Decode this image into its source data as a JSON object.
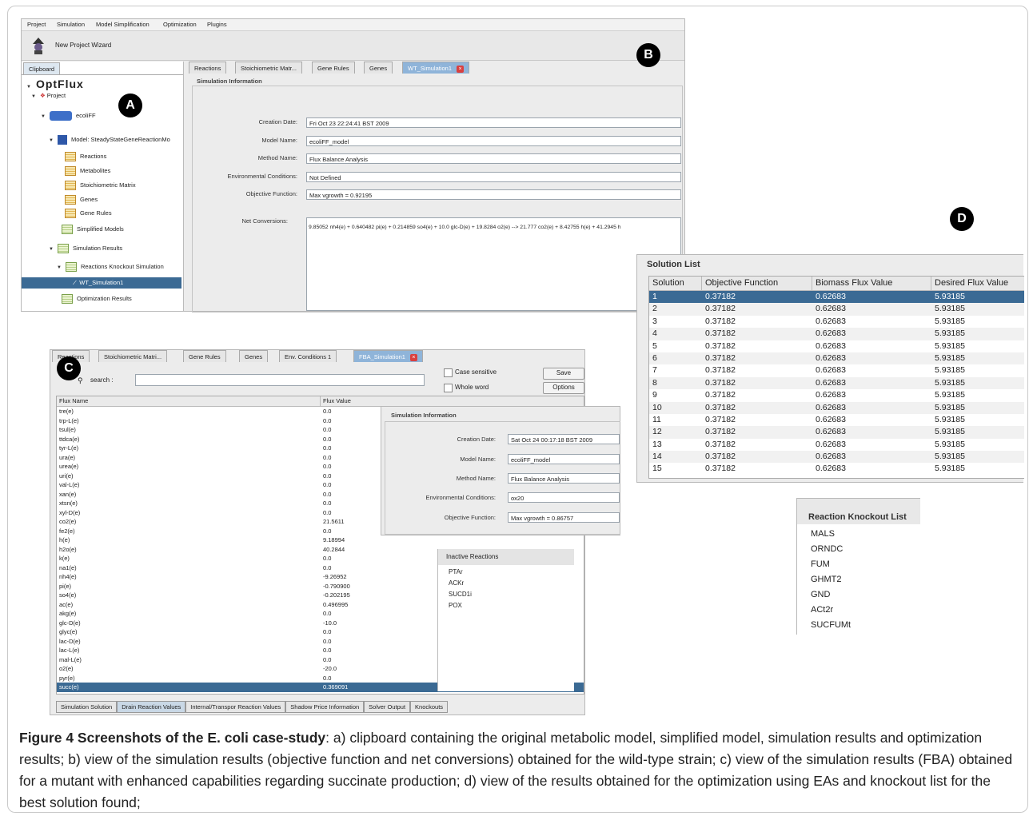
{
  "menu_items": [
    "Project",
    "Simulation",
    "Model Simplification",
    "Optimization",
    "Plugins"
  ],
  "toolbar": {
    "new_project": "New Project Wizard"
  },
  "badges": {
    "a": "A",
    "b": "B",
    "c": "C",
    "d": "D"
  },
  "panel_a": {
    "clipboard_tab": "Clipboard",
    "logo": "OptFlux",
    "tree": [
      {
        "label": "Project"
      },
      {
        "label": "ecoliFF"
      },
      {
        "label": "Model: SteadyStateGeneReactionMo"
      },
      {
        "label": "Reactions"
      },
      {
        "label": "Metabolites"
      },
      {
        "label": "Stoichiometric Matrix"
      },
      {
        "label": "Genes"
      },
      {
        "label": "Gene Rules"
      },
      {
        "label": "Simplified Models"
      },
      {
        "label": "Simulation Results"
      },
      {
        "label": "Reactions Knockout Simulation"
      },
      {
        "label": "WT_Simulation1"
      },
      {
        "label": "Optimization Results"
      }
    ]
  },
  "panel_b": {
    "tabs": [
      "Reactions",
      "Stoichiometric Matr...",
      "Gene Rules",
      "Genes",
      "WT_Simulation1"
    ],
    "section_title": "Simulation Information",
    "fields": [
      {
        "label": "Creation Date:",
        "value": "Fri Oct 23 22:24:41 BST 2009"
      },
      {
        "label": "Model Name:",
        "value": "ecoliFF_model"
      },
      {
        "label": "Method Name:",
        "value": "Flux Balance Analysis"
      },
      {
        "label": "Environmental Conditions:",
        "value": "Not Defined"
      },
      {
        "label": "Objective Function:",
        "value": "Max vgrowth  = 0.92195"
      }
    ],
    "net_label": "Net Conversions:",
    "net_value": "9.85052 nh4(e) + 0.640482 pi(e) + 0.214859 so4(e) + 10.0 glc-D(e) + 19.8284 o2(e) --> 21.777 co2(e) + 8.42755 h(e) + 41.2945 h"
  },
  "panel_c": {
    "tabs": [
      "Reactions",
      "Stoichiometric Matri...",
      "Gene Rules",
      "Genes",
      "Env. Conditions 1",
      "FBA_Simulation1"
    ],
    "search_label": "search :",
    "case_sensitive": "Case sensitive",
    "whole_word": "Whole word",
    "save": "Save",
    "options": "Options",
    "col_name": "Flux Name",
    "col_value": "Flux Value",
    "rows": [
      [
        "tre(e)",
        "0.0"
      ],
      [
        "trp-L(e)",
        "0.0"
      ],
      [
        "tsul(e)",
        "0.0"
      ],
      [
        "ttdca(e)",
        "0.0"
      ],
      [
        "tyr-L(e)",
        "0.0"
      ],
      [
        "ura(e)",
        "0.0"
      ],
      [
        "urea(e)",
        "0.0"
      ],
      [
        "uri(e)",
        "0.0"
      ],
      [
        "val-L(e)",
        "0.0"
      ],
      [
        "xan(e)",
        "0.0"
      ],
      [
        "xtsn(e)",
        "0.0"
      ],
      [
        "xyl-D(e)",
        "0.0"
      ],
      [
        "co2(e)",
        "21.5611"
      ],
      [
        "fe2(e)",
        "0.0"
      ],
      [
        "h(e)",
        "9.18994"
      ],
      [
        "h2o(e)",
        "40.2844"
      ],
      [
        "k(e)",
        "0.0"
      ],
      [
        "na1(e)",
        "0.0"
      ],
      [
        "nh4(e)",
        "-9.26952"
      ],
      [
        "pi(e)",
        "-0.790900"
      ],
      [
        "so4(e)",
        "-0.202195"
      ],
      [
        "ac(e)",
        "0.496995"
      ],
      [
        "akg(e)",
        "0.0"
      ],
      [
        "glc-D(e)",
        "-10.0"
      ],
      [
        "glyc(e)",
        "0.0"
      ],
      [
        "lac-D(e)",
        "0.0"
      ],
      [
        "lac-L(e)",
        "0.0"
      ],
      [
        "mal-L(e)",
        "0.0"
      ],
      [
        "o2(e)",
        "-20.0"
      ],
      [
        "pyr(e)",
        "0.0"
      ],
      [
        "succ(e)",
        "0.369091"
      ]
    ],
    "bottom_tabs": [
      "Simulation Solution",
      "Drain Reaction Values",
      "Internal/Transpor Reaction Values",
      "Shadow Price Information",
      "Solver Output",
      "Knockouts"
    ],
    "info": {
      "section_title": "Simulation Information",
      "fields": [
        {
          "label": "Creation Date:",
          "value": "Sat Oct 24 00:17:18 BST 2009"
        },
        {
          "label": "Model Name:",
          "value": "ecoliFF_model"
        },
        {
          "label": "Method Name:",
          "value": "Flux Balance Analysis"
        },
        {
          "label": "Environmental Conditions:",
          "value": "ox20"
        },
        {
          "label": "Objective Function:",
          "value": "Max vgrowth  = 0.86757"
        }
      ]
    },
    "inactive": {
      "title": "Inactive Reactions",
      "items": [
        "PTAr",
        "ACKr",
        "SUCD1i",
        "POX"
      ]
    }
  },
  "panel_d": {
    "title": "Solution List",
    "headers": [
      "Solution",
      "Objective Function",
      "Biomass Flux Value",
      "Desired Flux Value"
    ],
    "rows": [
      [
        "1",
        "0.37182",
        "0.62683",
        "5.93185"
      ],
      [
        "2",
        "0.37182",
        "0.62683",
        "5.93185"
      ],
      [
        "3",
        "0.37182",
        "0.62683",
        "5.93185"
      ],
      [
        "4",
        "0.37182",
        "0.62683",
        "5.93185"
      ],
      [
        "5",
        "0.37182",
        "0.62683",
        "5.93185"
      ],
      [
        "6",
        "0.37182",
        "0.62683",
        "5.93185"
      ],
      [
        "7",
        "0.37182",
        "0.62683",
        "5.93185"
      ],
      [
        "8",
        "0.37182",
        "0.62683",
        "5.93185"
      ],
      [
        "9",
        "0.37182",
        "0.62683",
        "5.93185"
      ],
      [
        "10",
        "0.37182",
        "0.62683",
        "5.93185"
      ],
      [
        "11",
        "0.37182",
        "0.62683",
        "5.93185"
      ],
      [
        "12",
        "0.37182",
        "0.62683",
        "5.93185"
      ],
      [
        "13",
        "0.37182",
        "0.62683",
        "5.93185"
      ],
      [
        "14",
        "0.37182",
        "0.62683",
        "5.93185"
      ],
      [
        "15",
        "0.37182",
        "0.62683",
        "5.93185"
      ]
    ],
    "knockout_title": "Reaction Knockout List",
    "knockouts": [
      "MALS",
      "ORNDC",
      "FUM",
      "GHMT2",
      "GND",
      "ACt2r",
      "SUCFUMt"
    ]
  },
  "caption": {
    "bold": "Figure 4 Screenshots of the E. coli case-study",
    "text": ": a) clipboard containing the original metabolic model, simplified model, simulation results and optimization results; b) view of the simulation results (objective function and net conversions) obtained for the wild-type strain; c) view of the simulation results (FBA) obtained for a mutant with enhanced capabilities regarding succinate production; d) view of the results obtained for the optimization using EAs and knockout list for the best solution found;"
  }
}
